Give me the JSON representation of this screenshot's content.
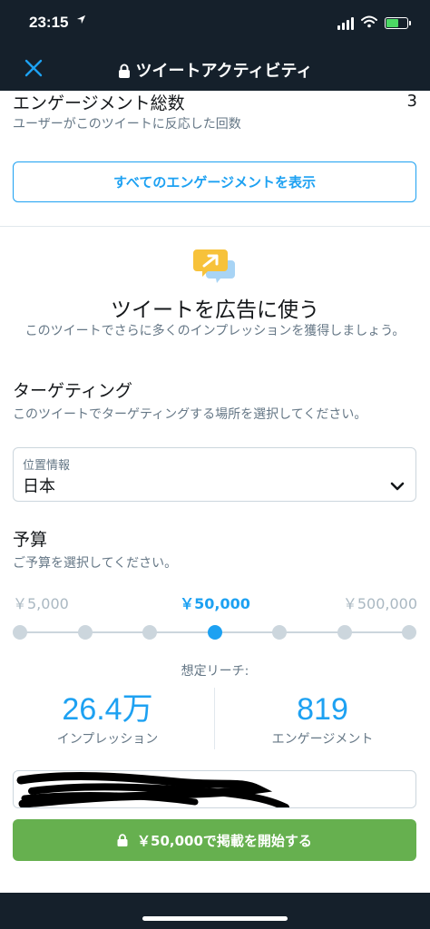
{
  "status_bar": {
    "time": "23:15",
    "location_icon": "location-arrow-icon"
  },
  "nav": {
    "title": "ツイートアクティビティ",
    "close_icon": "close-icon",
    "lock_icon": "lock-icon"
  },
  "engagement": {
    "title": "エンゲージメント総数",
    "subtitle": "ユーザーがこのツイートに反応した回数",
    "count": "3",
    "button_label": "すべてのエンゲージメントを表示"
  },
  "promote": {
    "icon": "promote-chat-icon",
    "title": "ツイートを広告に使う",
    "description": "このツイートでさらに多くのインプレッションを獲得しましょう。"
  },
  "targeting": {
    "title": "ターゲティング",
    "subtitle": "このツイートでターゲティングする場所を選択してください。",
    "field_label": "位置情報",
    "field_value": "日本"
  },
  "budget": {
    "title": "予算",
    "subtitle": "ご予算を選択してください。",
    "labels": [
      "￥5,000",
      "￥50,000",
      "￥500,000"
    ],
    "selected_index": 3,
    "steps": 7
  },
  "reach": {
    "label": "想定リーチ:",
    "impressions_value": "26.4万",
    "impressions_label": "インプレッション",
    "engagements_value": "819",
    "engagements_label": "エンゲージメント"
  },
  "start_button": {
    "label": "￥50,000で掲載を開始する"
  },
  "colors": {
    "accent": "#1da1f2",
    "dark": "#15202b",
    "green": "#66b04f",
    "muted": "#657786"
  }
}
